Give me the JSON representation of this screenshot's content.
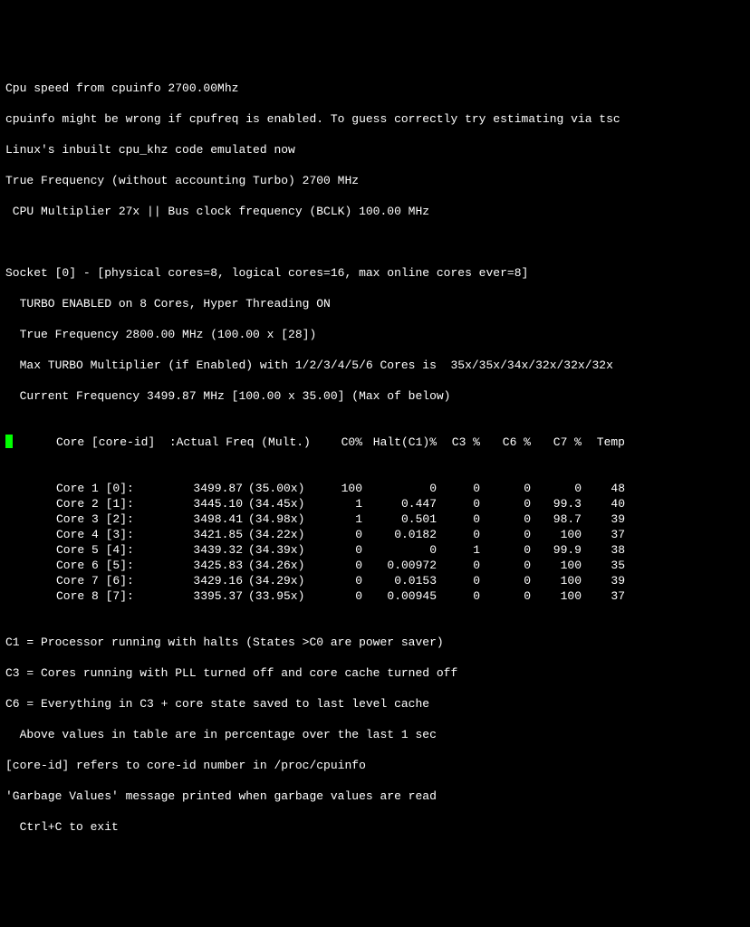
{
  "header": {
    "line1": "Cpu speed from cpuinfo 2700.00Mhz",
    "line2": "cpuinfo might be wrong if cpufreq is enabled. To guess correctly try estimating via tsc",
    "line3": "Linux's inbuilt cpu_khz code emulated now",
    "line4": "True Frequency (without accounting Turbo) 2700 MHz",
    "line5": " CPU Multiplier 27x || Bus clock frequency (BCLK) 100.00 MHz"
  },
  "socket": {
    "line1": "Socket [0] - [physical cores=8, logical cores=16, max online cores ever=8]",
    "line2": "  TURBO ENABLED on 8 Cores, Hyper Threading ON",
    "line3": "  True Frequency 2800.00 MHz (100.00 x [28])",
    "line4": "  Max TURBO Multiplier (if Enabled) with 1/2/3/4/5/6 Cores is  35x/35x/34x/32x/32x/32x",
    "line5": "  Current Frequency 3499.87 MHz [100.00 x 35.00] (Max of below)"
  },
  "table": {
    "hdr_core": "Core [core-id]  :Actual Freq (Mult.)",
    "hdr_c0": "C0%",
    "hdr_halt": "Halt(C1)%",
    "hdr_c3": "C3 %",
    "hdr_c6": "C6 %",
    "hdr_c7": "C7 %",
    "hdr_temp": "Temp",
    "rows": [
      {
        "core": "Core 1 [0]:",
        "freq": "3499.87",
        "mult": "(35.00x)",
        "c0": "100",
        "halt": "0",
        "c3": "0",
        "c6": "0",
        "c7": "0",
        "temp": "48"
      },
      {
        "core": "Core 2 [1]:",
        "freq": "3445.10",
        "mult": "(34.45x)",
        "c0": "1",
        "halt": "0.447",
        "c3": "0",
        "c6": "0",
        "c7": "99.3",
        "temp": "40"
      },
      {
        "core": "Core 3 [2]:",
        "freq": "3498.41",
        "mult": "(34.98x)",
        "c0": "1",
        "halt": "0.501",
        "c3": "0",
        "c6": "0",
        "c7": "98.7",
        "temp": "39"
      },
      {
        "core": "Core 4 [3]:",
        "freq": "3421.85",
        "mult": "(34.22x)",
        "c0": "0",
        "halt": "0.0182",
        "c3": "0",
        "c6": "0",
        "c7": "100",
        "temp": "37"
      },
      {
        "core": "Core 5 [4]:",
        "freq": "3439.32",
        "mult": "(34.39x)",
        "c0": "0",
        "halt": "0",
        "c3": "1",
        "c6": "0",
        "c7": "99.9",
        "temp": "38"
      },
      {
        "core": "Core 6 [5]:",
        "freq": "3425.83",
        "mult": "(34.26x)",
        "c0": "0",
        "halt": "0.00972",
        "c3": "0",
        "c6": "0",
        "c7": "100",
        "temp": "35"
      },
      {
        "core": "Core 7 [6]:",
        "freq": "3429.16",
        "mult": "(34.29x)",
        "c0": "0",
        "halt": "0.0153",
        "c3": "0",
        "c6": "0",
        "c7": "100",
        "temp": "39"
      },
      {
        "core": "Core 8 [7]:",
        "freq": "3395.37",
        "mult": "(33.95x)",
        "c0": "0",
        "halt": "0.00945",
        "c3": "0",
        "c6": "0",
        "c7": "100",
        "temp": "37"
      }
    ]
  },
  "footer": {
    "line1": "C1 = Processor running with halts (States >C0 are power saver)",
    "line2": "C3 = Cores running with PLL turned off and core cache turned off",
    "line3": "C6 = Everything in C3 + core state saved to last level cache",
    "line4": "  Above values in table are in percentage over the last 1 sec",
    "line5": "[core-id] refers to core-id number in /proc/cpuinfo",
    "line6": "'Garbage Values' message printed when garbage values are read",
    "line7": "  Ctrl+C to exit"
  },
  "chart_data": {
    "type": "table",
    "title": "Per-core CPU frequency and C-state percentages (i7z)",
    "columns": [
      "Core",
      "core-id",
      "Actual Freq (MHz)",
      "Multiplier",
      "C0%",
      "Halt(C1)%",
      "C3 %",
      "C6 %",
      "C7 %",
      "Temp"
    ],
    "rows": [
      [
        "Core 1",
        0,
        3499.87,
        35.0,
        100,
        0,
        0,
        0,
        0,
        48
      ],
      [
        "Core 2",
        1,
        3445.1,
        34.45,
        1,
        0.447,
        0,
        0,
        99.3,
        40
      ],
      [
        "Core 3",
        2,
        3498.41,
        34.98,
        1,
        0.501,
        0,
        0,
        98.7,
        39
      ],
      [
        "Core 4",
        3,
        3421.85,
        34.22,
        0,
        0.0182,
        0,
        0,
        100,
        37
      ],
      [
        "Core 5",
        4,
        3439.32,
        34.39,
        0,
        0,
        1,
        0,
        99.9,
        38
      ],
      [
        "Core 6",
        5,
        3425.83,
        34.26,
        0,
        0.00972,
        0,
        0,
        100,
        35
      ],
      [
        "Core 7",
        6,
        3429.16,
        34.29,
        0,
        0.0153,
        0,
        0,
        100,
        39
      ],
      [
        "Core 8",
        7,
        3395.37,
        33.95,
        0,
        0.00945,
        0,
        0,
        100,
        37
      ]
    ],
    "meta": {
      "socket": 0,
      "physical_cores": 8,
      "logical_cores": 16,
      "turbo_enabled": true,
      "hyper_threading": true,
      "true_frequency_mhz": 2800.0,
      "bclk_mhz": 100.0,
      "max_turbo_multipliers": {
        "1": 35,
        "2": 35,
        "3": 34,
        "4": 32,
        "5": 32,
        "6": 32
      },
      "current_frequency_mhz": 3499.87
    }
  }
}
